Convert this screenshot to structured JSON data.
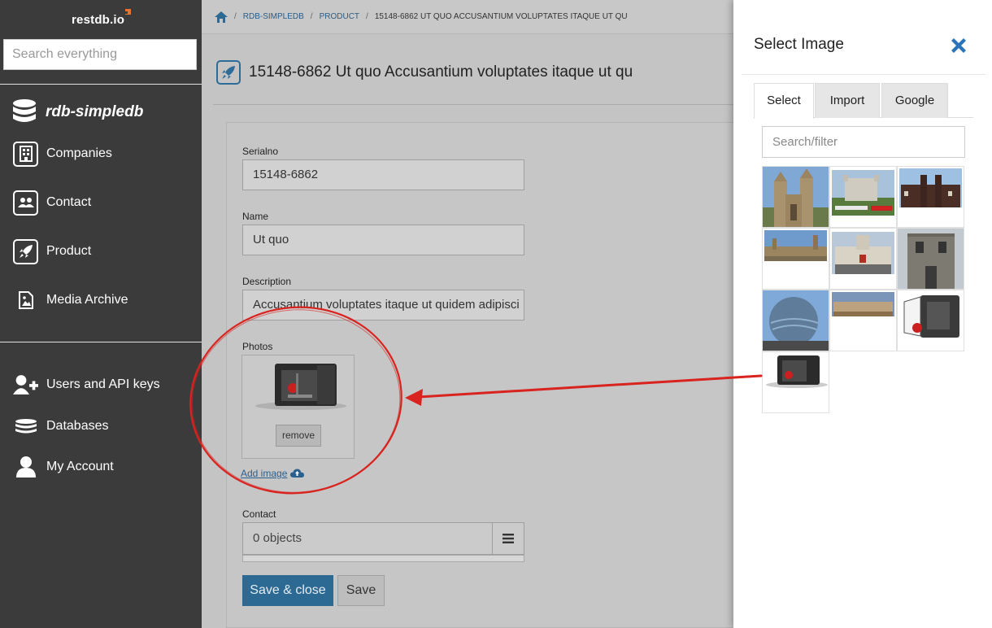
{
  "sidebar": {
    "logo": "restdb.io",
    "search_placeholder": "Search everything",
    "database_name": "rdb-simpledb",
    "items": [
      {
        "label": "Companies",
        "icon": "building-icon"
      },
      {
        "label": "Contact",
        "icon": "users-icon"
      },
      {
        "label": "Product",
        "icon": "rocket-icon"
      },
      {
        "label": "Media Archive",
        "icon": "image-file-icon"
      }
    ],
    "admin_items": [
      {
        "label": "Users and API keys",
        "icon": "user-plus-icon"
      },
      {
        "label": "Databases",
        "icon": "database-stack-icon"
      },
      {
        "label": "My Account",
        "icon": "user-icon"
      }
    ]
  },
  "breadcrumb": {
    "items": [
      "RDB-SIMPLEDB",
      "PRODUCT"
    ],
    "current": "15148-6862 UT QUO ACCUSANTIUM VOLUPTATES ITAQUE UT QU"
  },
  "page": {
    "title": "15148-6862 Ut quo Accusantium voluptates itaque ut qu"
  },
  "form": {
    "serialno_label": "Serialno",
    "serialno_value": "15148-6862",
    "name_label": "Name",
    "name_value": "Ut quo",
    "description_label": "Description",
    "description_value": "Accusantium voluptates itaque ut quidem adipisci",
    "photos_label": "Photos",
    "remove_label": "remove",
    "add_image_label": "Add image",
    "contact_label": "Contact",
    "contact_value": "0 objects",
    "save_close_label": "Save & close",
    "save_label": "Save"
  },
  "image_panel": {
    "title": "Select Image",
    "tabs": [
      "Select",
      "Import",
      "Google"
    ],
    "active_tab": "Select",
    "filter_placeholder": "Search/filter",
    "thumbnails": [
      {
        "name": "westminster-abbey"
      },
      {
        "name": "tower-of-london"
      },
      {
        "name": "st-james-palace"
      },
      {
        "name": "houses-of-parliament"
      },
      {
        "name": "horse-guards"
      },
      {
        "name": "stone-tower"
      },
      {
        "name": "city-hall"
      },
      {
        "name": "buckingham-palace"
      },
      {
        "name": "3d-printer-open"
      },
      {
        "name": "3d-printer"
      }
    ]
  },
  "colors": {
    "sidebar_bg": "#3b3b3b",
    "accent": "#2d6a93",
    "logo_accent": "#e8742a",
    "annotation": "#d9231f"
  }
}
